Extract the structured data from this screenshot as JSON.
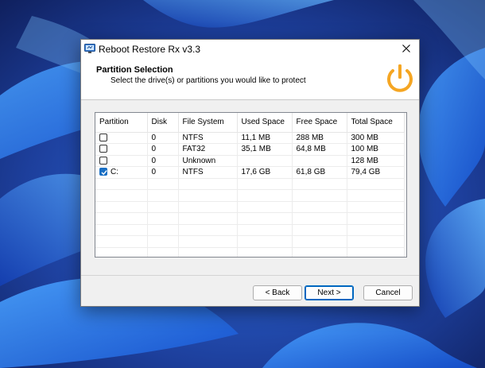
{
  "window": {
    "title": "Reboot Restore Rx v3.3"
  },
  "header": {
    "title": "Partition Selection",
    "subtitle": "Select the drive(s) or partitions you would like to protect"
  },
  "table": {
    "columns": [
      "Partition",
      "Disk",
      "File System",
      "Used Space",
      "Free Space",
      "Total Space"
    ],
    "rows": [
      {
        "checked": false,
        "partition": "",
        "disk": "0",
        "fs": "NTFS",
        "used": "11,1 MB",
        "free": "288 MB",
        "total": "300 MB"
      },
      {
        "checked": false,
        "partition": "",
        "disk": "0",
        "fs": "FAT32",
        "used": "35,1 MB",
        "free": "64,8 MB",
        "total": "100 MB"
      },
      {
        "checked": false,
        "partition": "",
        "disk": "0",
        "fs": "Unknown",
        "used": "",
        "free": "",
        "total": "128 MB"
      },
      {
        "checked": true,
        "partition": "C:",
        "disk": "0",
        "fs": "NTFS",
        "used": "17,6 GB",
        "free": "61,8 GB",
        "total": "79,4 GB"
      }
    ]
  },
  "buttons": {
    "back": "< Back",
    "next": "Next >",
    "cancel": "Cancel"
  },
  "icons": {
    "app": "reboot-restore-app-icon",
    "close": "close-icon",
    "power": "power-icon",
    "check": "checkmark-icon"
  },
  "colors": {
    "accent": "#0067c0",
    "power_icon": "#f5a623",
    "checkbox_checked": "#1a6fc4"
  }
}
